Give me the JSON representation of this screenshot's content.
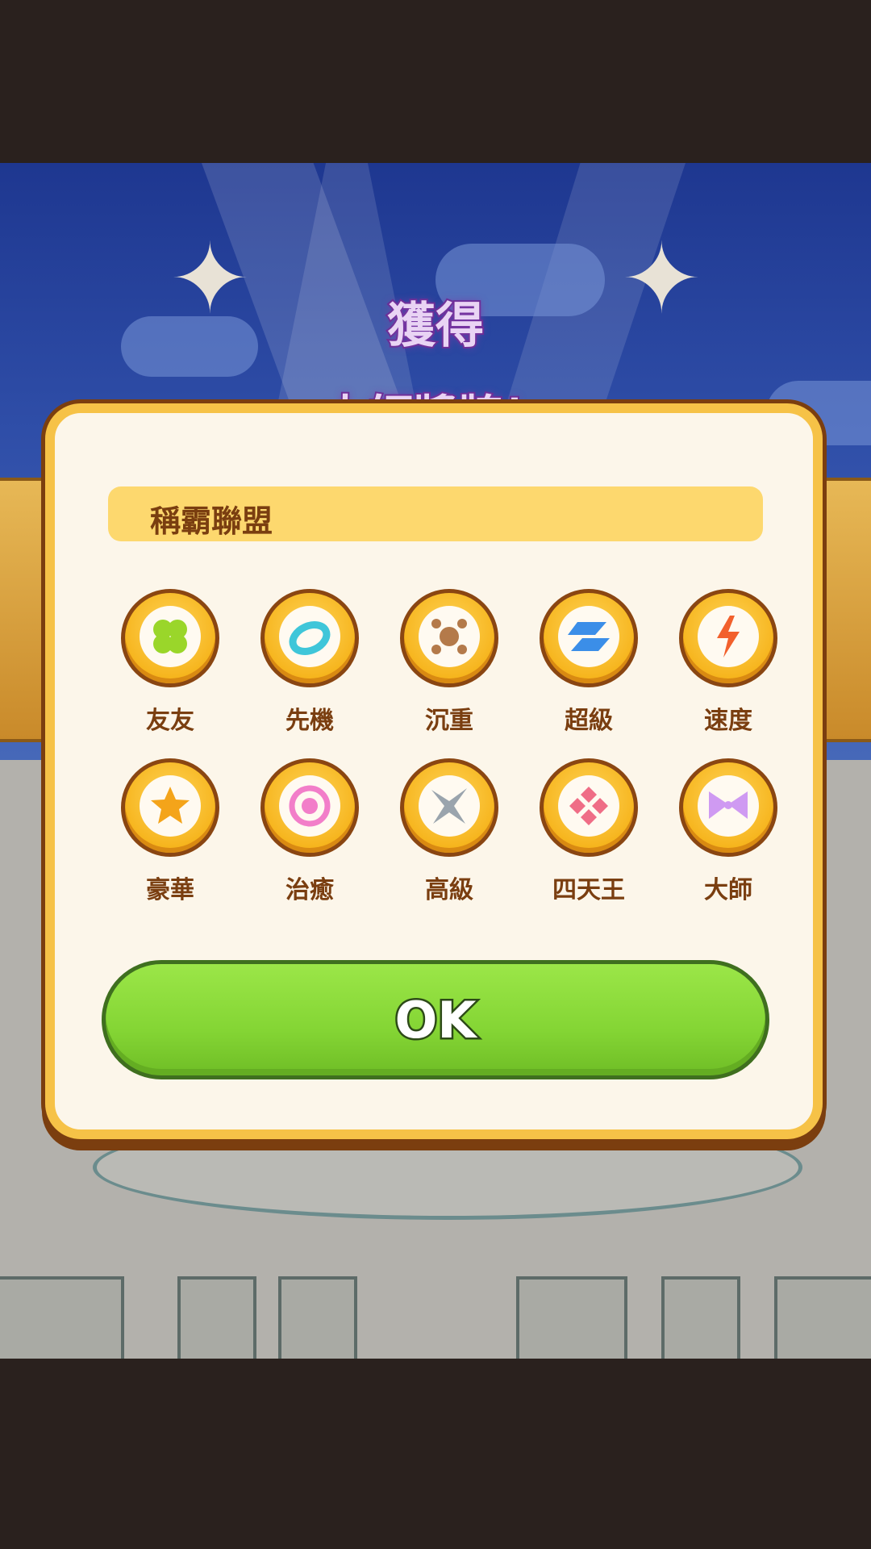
{
  "header": {
    "title_line1": "獲得",
    "title_line2": "大師獎牌！"
  },
  "dialog": {
    "league_name": "稱霸聯盟",
    "badges": [
      {
        "label": "友友",
        "icon": "clover-icon",
        "color": "#9ad62a"
      },
      {
        "label": "先機",
        "icon": "swirl-icon",
        "color": "#3fc6d9"
      },
      {
        "label": "沉重",
        "icon": "weight-icon",
        "color": "#b47a4a"
      },
      {
        "label": "超級",
        "icon": "super-icon",
        "color": "#3b8ee8"
      },
      {
        "label": "速度",
        "icon": "lightning-icon",
        "color": "#f2602c"
      },
      {
        "label": "豪華",
        "icon": "star-icon",
        "color": "#f4a41a"
      },
      {
        "label": "治癒",
        "icon": "ring-icon",
        "color": "#f27ec9"
      },
      {
        "label": "高級",
        "icon": "shuriken-icon",
        "color": "#9aa4ad"
      },
      {
        "label": "四天王",
        "icon": "diamonds-icon",
        "color": "#ef6d86"
      },
      {
        "label": "大師",
        "icon": "bowtie-icon",
        "color": "#cf9af2"
      }
    ],
    "ok_label": "OK"
  }
}
